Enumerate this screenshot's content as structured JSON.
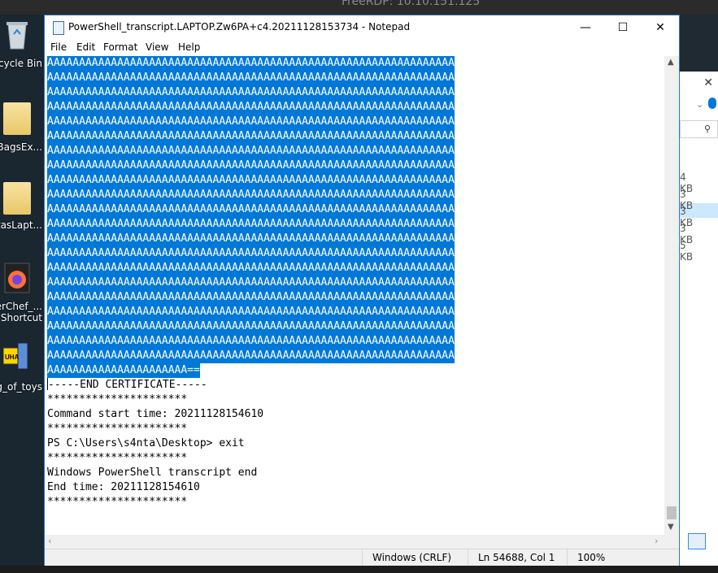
{
  "rdp": {
    "title": "FreeRDP: 10.10.151.125"
  },
  "desktop": {
    "icons": [
      {
        "label": "ecycle Bin"
      },
      {
        "label": "ellBagsEx..."
      },
      {
        "label": "ntasLapt..."
      },
      {
        "label1": "berChef_...",
        "label2": "Shortcut"
      },
      {
        "label": "g_of_toys"
      }
    ]
  },
  "explorer": {
    "sizes": [
      "4 KB",
      "3 KB",
      "3 KB",
      "3 KB",
      "5 KB"
    ]
  },
  "notepad": {
    "title": "PowerShell_transcript.LAPTOP.Zw6PA+c4.20211128153734 - Notepad",
    "controls": {
      "minimize": "—",
      "maximize": "☐",
      "close": "✕"
    },
    "menu": [
      "File",
      "Edit",
      "Format",
      "View",
      "Help"
    ],
    "selected_lines": [
      "AAAAAAAAAAAAAAAAAAAAAAAAAAAAAAAAAAAAAAAAAAAAAAAAAAAAAAAAAAAAAAAA",
      "AAAAAAAAAAAAAAAAAAAAAAAAAAAAAAAAAAAAAAAAAAAAAAAAAAAAAAAAAAAAAAAA",
      "AAAAAAAAAAAAAAAAAAAAAAAAAAAAAAAAAAAAAAAAAAAAAAAAAAAAAAAAAAAAAAAA",
      "AAAAAAAAAAAAAAAAAAAAAAAAAAAAAAAAAAAAAAAAAAAAAAAAAAAAAAAAAAAAAAAA",
      "AAAAAAAAAAAAAAAAAAAAAAAAAAAAAAAAAAAAAAAAAAAAAAAAAAAAAAAAAAAAAAAA",
      "AAAAAAAAAAAAAAAAAAAAAAAAAAAAAAAAAAAAAAAAAAAAAAAAAAAAAAAAAAAAAAAA",
      "AAAAAAAAAAAAAAAAAAAAAAAAAAAAAAAAAAAAAAAAAAAAAAAAAAAAAAAAAAAAAAAA",
      "AAAAAAAAAAAAAAAAAAAAAAAAAAAAAAAAAAAAAAAAAAAAAAAAAAAAAAAAAAAAAAAA",
      "AAAAAAAAAAAAAAAAAAAAAAAAAAAAAAAAAAAAAAAAAAAAAAAAAAAAAAAAAAAAAAAA",
      "AAAAAAAAAAAAAAAAAAAAAAAAAAAAAAAAAAAAAAAAAAAAAAAAAAAAAAAAAAAAAAAA",
      "AAAAAAAAAAAAAAAAAAAAAAAAAAAAAAAAAAAAAAAAAAAAAAAAAAAAAAAAAAAAAAAA",
      "AAAAAAAAAAAAAAAAAAAAAAAAAAAAAAAAAAAAAAAAAAAAAAAAAAAAAAAAAAAAAAAA",
      "AAAAAAAAAAAAAAAAAAAAAAAAAAAAAAAAAAAAAAAAAAAAAAAAAAAAAAAAAAAAAAAA",
      "AAAAAAAAAAAAAAAAAAAAAAAAAAAAAAAAAAAAAAAAAAAAAAAAAAAAAAAAAAAAAAAA",
      "AAAAAAAAAAAAAAAAAAAAAAAAAAAAAAAAAAAAAAAAAAAAAAAAAAAAAAAAAAAAAAAA",
      "AAAAAAAAAAAAAAAAAAAAAAAAAAAAAAAAAAAAAAAAAAAAAAAAAAAAAAAAAAAAAAAA",
      "AAAAAAAAAAAAAAAAAAAAAAAAAAAAAAAAAAAAAAAAAAAAAAAAAAAAAAAAAAAAAAAA",
      "AAAAAAAAAAAAAAAAAAAAAAAAAAAAAAAAAAAAAAAAAAAAAAAAAAAAAAAAAAAAAAAA",
      "AAAAAAAAAAAAAAAAAAAAAAAAAAAAAAAAAAAAAAAAAAAAAAAAAAAAAAAAAAAAAAAA",
      "AAAAAAAAAAAAAAAAAAAAAAAAAAAAAAAAAAAAAAAAAAAAAAAAAAAAAAAAAAAAAAAA",
      "AAAAAAAAAAAAAAAAAAAAAAAAAAAAAAAAAAAAAAAAAAAAAAAAAAAAAAAAAAAAAAAA",
      "AAAAAAAAAAAAAAAAAAAAAA=="
    ],
    "plain_lines": [
      "-----END CERTIFICATE-----",
      "**********************",
      "Command start time: 20211128154610",
      "**********************",
      "PS C:\\Users\\s4nta\\Desktop> exit",
      "**********************",
      "Windows PowerShell transcript end",
      "End time: 20211128154610",
      "**********************"
    ],
    "status": {
      "encoding": "Windows (CRLF)",
      "position": "Ln 54688, Col 1",
      "zoom": "100%"
    }
  }
}
